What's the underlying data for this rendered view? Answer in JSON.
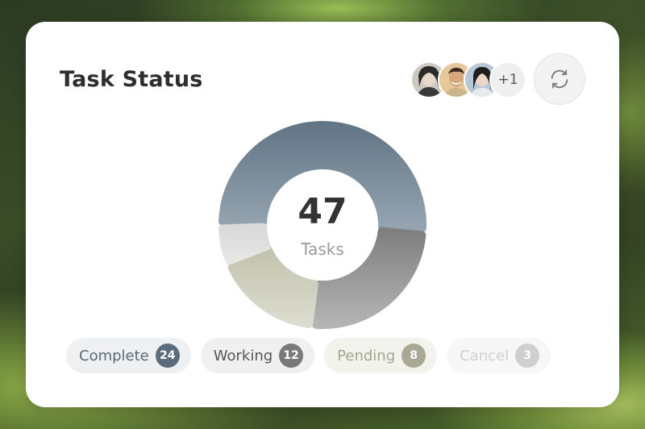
{
  "card": {
    "title": "Task Status"
  },
  "avatars": {
    "icons": [
      "person-avatar",
      "person-avatar",
      "person-avatar"
    ],
    "overflow_label": "+1"
  },
  "refresh": {
    "icon": "refresh-icon"
  },
  "chart_data": {
    "type": "pie",
    "subtype": "donut",
    "total": 47,
    "center_label": "Tasks",
    "categories": [
      "Complete",
      "Working",
      "Pending",
      "Cancel"
    ],
    "values": [
      24,
      12,
      8,
      3
    ],
    "colors": [
      "#687a8a",
      "#8e8e8e",
      "#bfbfaa",
      "#dcdcdc"
    ]
  },
  "legend": [
    {
      "label": "Complete",
      "count": "24",
      "bg": "#eef0f2",
      "text": "#5a6a7a",
      "badge": "#5b6c7c"
    },
    {
      "label": "Working",
      "count": "12",
      "bg": "#f0f0f0",
      "text": "#555555",
      "badge": "#7a7a7a"
    },
    {
      "label": "Pending",
      "count": "8",
      "bg": "#f3f3ee",
      "text": "#a5a58f",
      "badge": "#a8a894"
    },
    {
      "label": "Cancel",
      "count": "3",
      "bg": "#f7f7f7",
      "text": "#cfcfcf",
      "badge": "#cfcfcf"
    }
  ]
}
